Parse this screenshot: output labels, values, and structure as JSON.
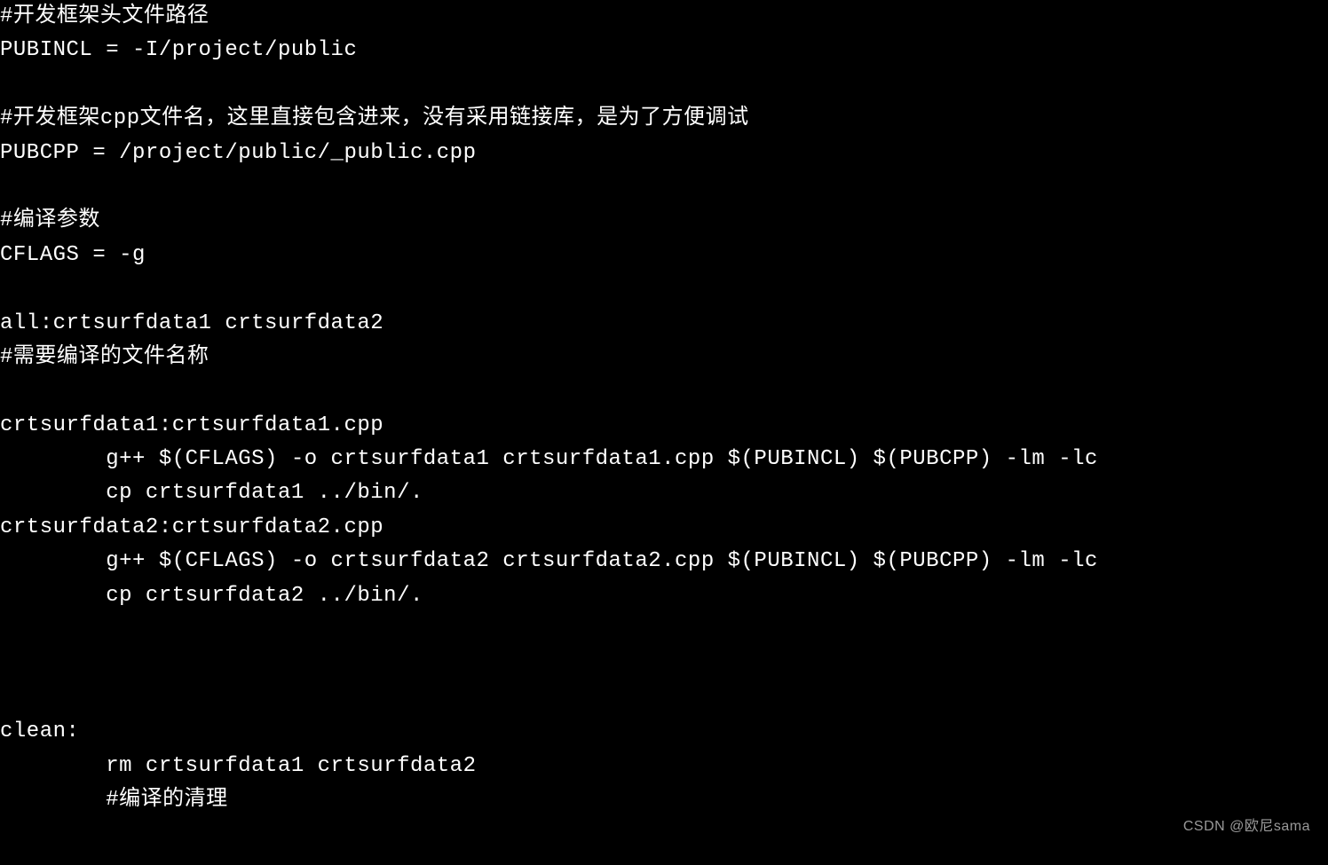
{
  "lines": [
    "#开发框架头文件路径",
    "PUBINCL = -I/project/public",
    "",
    "#开发框架cpp文件名，这里直接包含进来，没有采用链接库，是为了方便调试",
    "PUBCPP = /project/public/_public.cpp",
    "",
    "#编译参数",
    "CFLAGS = -g",
    "",
    "all:crtsurfdata1 crtsurfdata2",
    "#需要编译的文件名称",
    "",
    "crtsurfdata1:crtsurfdata1.cpp",
    "        g++ $(CFLAGS) -o crtsurfdata1 crtsurfdata1.cpp $(PUBINCL) $(PUBCPP) -lm -lc",
    "        cp crtsurfdata1 ../bin/.",
    "crtsurfdata2:crtsurfdata2.cpp",
    "        g++ $(CFLAGS) -o crtsurfdata2 crtsurfdata2.cpp $(PUBINCL) $(PUBCPP) -lm -lc",
    "        cp crtsurfdata2 ../bin/.",
    "",
    "",
    "",
    "clean:",
    "        rm crtsurfdata1 crtsurfdata2",
    "        #编译的清理"
  ],
  "watermark": "CSDN @欧尼sama"
}
